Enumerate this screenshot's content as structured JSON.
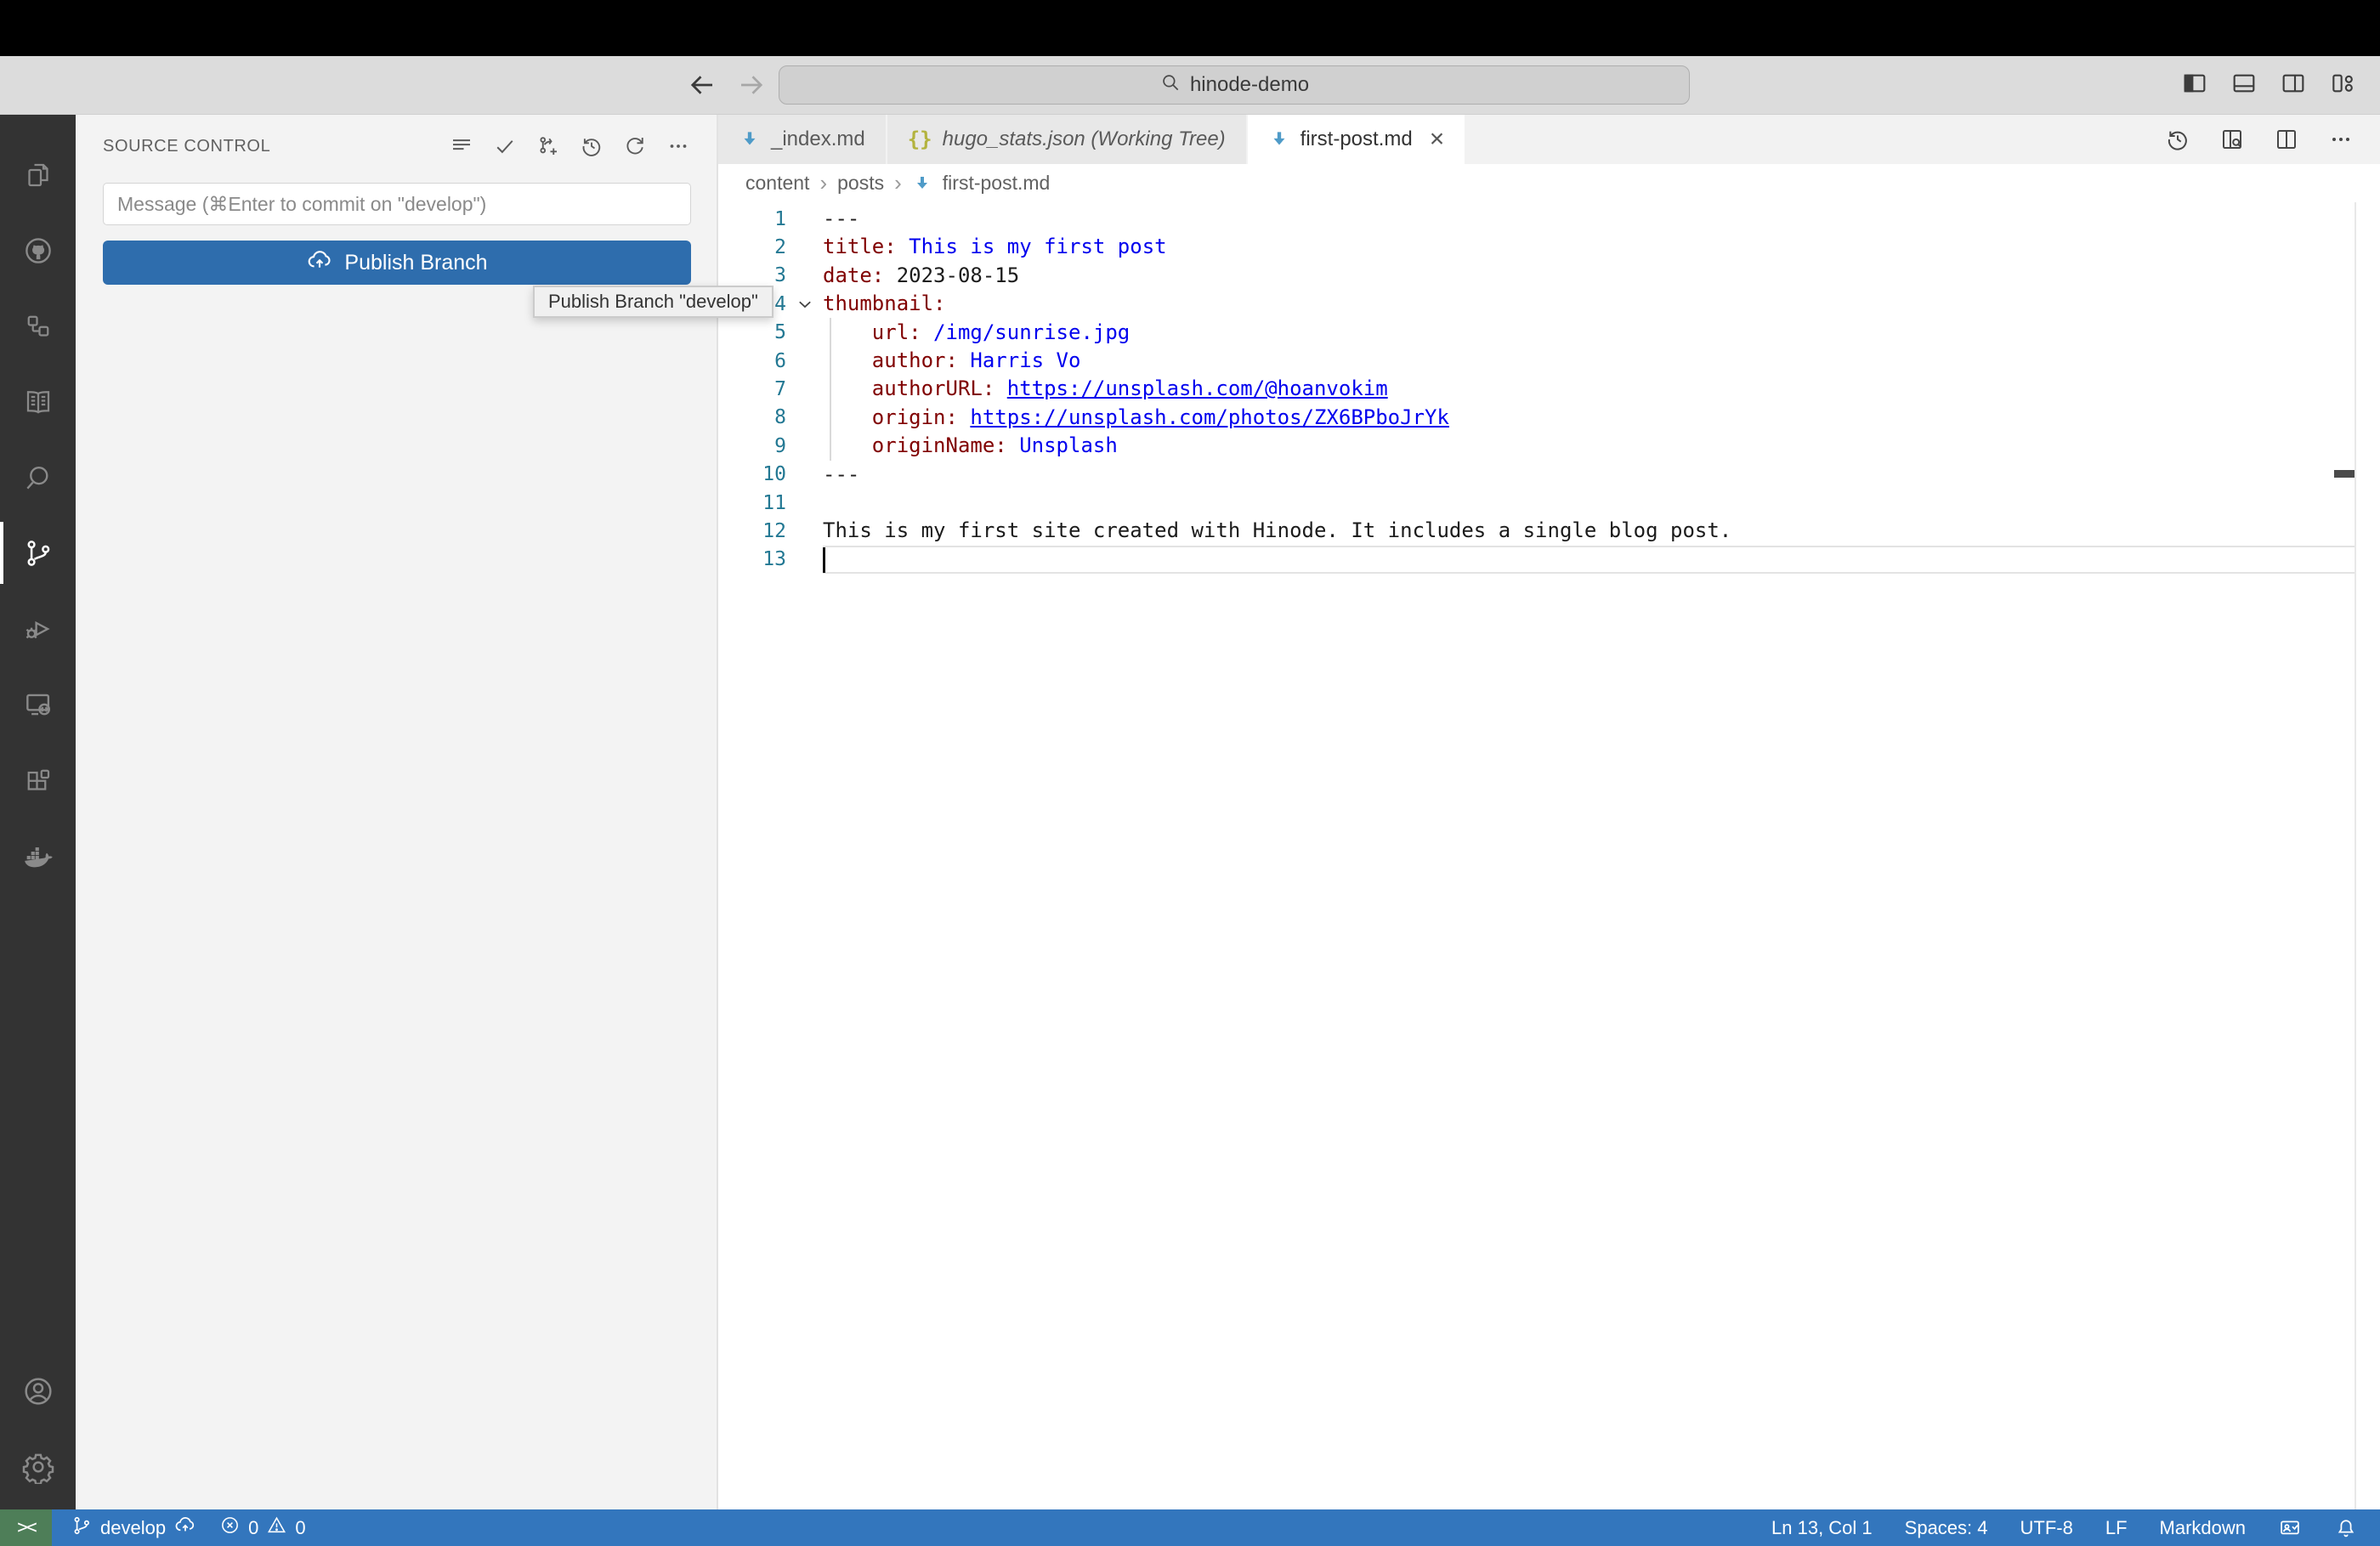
{
  "titlebar": {
    "search_value": "hinode-demo"
  },
  "activity_bar": {
    "items": [
      "explorer",
      "github",
      "symbols",
      "docs-book",
      "search",
      "source-control",
      "run-debug",
      "remote-explorer",
      "extensions",
      "docker"
    ],
    "active_item": "source-control",
    "bottom_items": [
      "account",
      "settings"
    ]
  },
  "source_control": {
    "title": "SOURCE CONTROL",
    "actions": [
      "view-as-list",
      "commit",
      "create-branch",
      "history",
      "refresh",
      "more-actions"
    ],
    "message_placeholder": "Message (⌘Enter to commit on \"develop\")",
    "publish_button": "Publish Branch",
    "tooltip": "Publish Branch \"develop\""
  },
  "editor": {
    "tabs": [
      {
        "label": "_index.md",
        "icon": "markdown",
        "active": false,
        "italic": false
      },
      {
        "label": "hugo_stats.json (Working Tree)",
        "icon": "json",
        "active": false,
        "italic": true
      },
      {
        "label": "first-post.md",
        "icon": "markdown",
        "active": true,
        "italic": false
      }
    ],
    "actions": [
      "history",
      "open-preview",
      "split-editor",
      "more-actions"
    ],
    "breadcrumb": {
      "items": [
        "content",
        "posts"
      ],
      "file": "first-post.md"
    },
    "code": {
      "language": "markdown",
      "lines": [
        {
          "num": 1,
          "tokens": [
            {
              "t": "---",
              "c": "meta"
            }
          ]
        },
        {
          "num": 2,
          "tokens": [
            {
              "t": "title:",
              "c": "key"
            },
            {
              "t": " ",
              "c": "plain"
            },
            {
              "t": "This is my first post",
              "c": "val"
            }
          ]
        },
        {
          "num": 3,
          "tokens": [
            {
              "t": "date:",
              "c": "key"
            },
            {
              "t": " 2023-08-15",
              "c": "plain"
            }
          ]
        },
        {
          "num": 4,
          "fold": true,
          "tokens": [
            {
              "t": "thumbnail:",
              "c": "key"
            }
          ]
        },
        {
          "num": 5,
          "tokens": [
            {
              "t": "    ",
              "c": "plain"
            },
            {
              "t": "url:",
              "c": "key"
            },
            {
              "t": " ",
              "c": "plain"
            },
            {
              "t": "/img/sunrise.jpg",
              "c": "val"
            }
          ]
        },
        {
          "num": 6,
          "tokens": [
            {
              "t": "    ",
              "c": "plain"
            },
            {
              "t": "author:",
              "c": "key"
            },
            {
              "t": " ",
              "c": "plain"
            },
            {
              "t": "Harris Vo",
              "c": "val"
            }
          ]
        },
        {
          "num": 7,
          "tokens": [
            {
              "t": "    ",
              "c": "plain"
            },
            {
              "t": "authorURL:",
              "c": "key"
            },
            {
              "t": " ",
              "c": "plain"
            },
            {
              "t": "https://unsplash.com/@hoanvokim",
              "c": "link"
            }
          ]
        },
        {
          "num": 8,
          "tokens": [
            {
              "t": "    ",
              "c": "plain"
            },
            {
              "t": "origin:",
              "c": "key"
            },
            {
              "t": " ",
              "c": "plain"
            },
            {
              "t": "https://unsplash.com/photos/ZX6BPboJrYk",
              "c": "link"
            }
          ]
        },
        {
          "num": 9,
          "tokens": [
            {
              "t": "    ",
              "c": "plain"
            },
            {
              "t": "originName:",
              "c": "key"
            },
            {
              "t": " ",
              "c": "plain"
            },
            {
              "t": "Unsplash",
              "c": "val"
            }
          ]
        },
        {
          "num": 10,
          "tokens": [
            {
              "t": "---",
              "c": "meta"
            }
          ]
        },
        {
          "num": 11,
          "tokens": []
        },
        {
          "num": 12,
          "tokens": [
            {
              "t": "This is my first site created with Hinode. It includes a single blog post.",
              "c": "plain"
            }
          ]
        },
        {
          "num": 13,
          "cursor": true,
          "current": true,
          "tokens": []
        }
      ]
    }
  },
  "status_bar": {
    "branch": "develop",
    "errors": "0",
    "warnings": "0",
    "line_col": "Ln 13, Col 1",
    "spaces": "Spaces: 4",
    "encoding": "UTF-8",
    "eol": "LF",
    "language": "Markdown"
  },
  "colors": {
    "status_bar_blue": "#3376bd",
    "remote_green": "#4e7e58",
    "publish_button_blue": "#2e6dad",
    "value_blue": "#0000ee",
    "key_red": "#800000",
    "line_number_teal": "#237893",
    "markdown_icon_blue": "#4f9bc8",
    "json_icon_yellow": "#b3b33f",
    "activity_bar_dark": "#333333"
  }
}
